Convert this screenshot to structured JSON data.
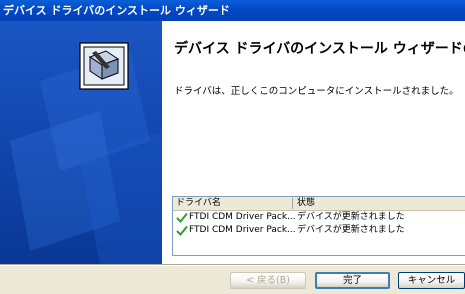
{
  "window": {
    "title": "デバイス ドライバのインストール ウィザード"
  },
  "content": {
    "heading": "デバイス ドライバのインストール ウィザードの完了",
    "message": "ドライバは、正しくこのコンピュータにインストールされました。"
  },
  "list": {
    "columns": [
      "ドライバ名",
      "状態"
    ],
    "rows": [
      {
        "name": "FTDI CDM Driver Pack...",
        "status": "デバイスが更新されました",
        "icon": "green-check-icon"
      },
      {
        "name": "FTDI CDM Driver Pack...",
        "status": "デバイスが更新されました",
        "icon": "green-check-icon"
      }
    ]
  },
  "buttons": {
    "back": "< 戻る(B)",
    "finish": "完了",
    "cancel": "キャンセル"
  },
  "colors": {
    "titlebar": "#0349c5",
    "sidepanel": "#0b3fa8",
    "check": "#2e9e2e"
  }
}
